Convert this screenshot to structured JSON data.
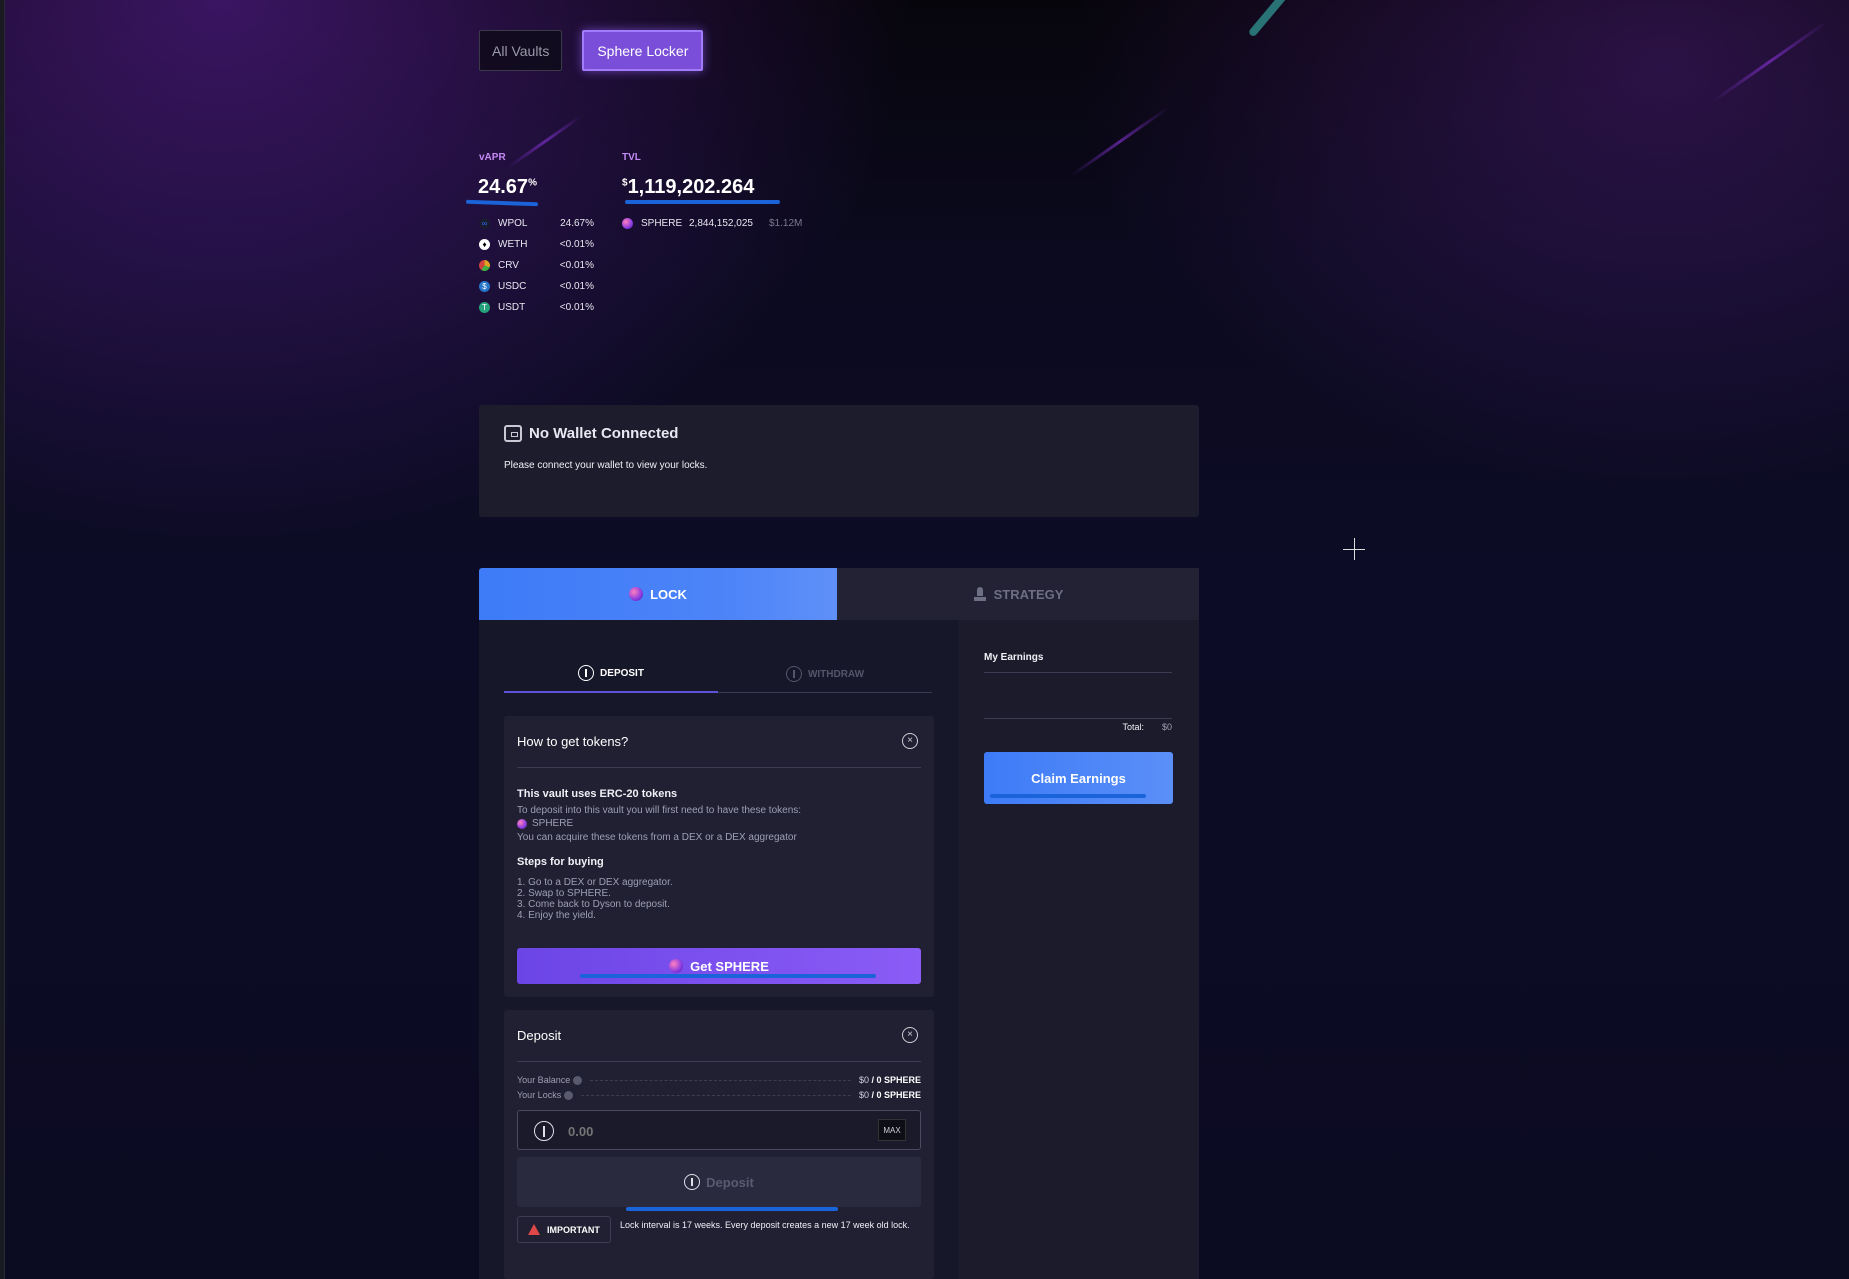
{
  "top_tabs": {
    "all_vaults": "All Vaults",
    "sphere_locker": "Sphere Locker"
  },
  "stats": {
    "vapr_label": "vAPR",
    "vapr_value": "24.67",
    "vapr_unit": "%",
    "tvl_label": "TVL",
    "tvl_currency": "$",
    "tvl_value": "1,119,202.264",
    "apr_breakdown": [
      {
        "token": "WPOL",
        "value": "24.67%",
        "icon": "wpol-icon",
        "color": "#2b6bf3"
      },
      {
        "token": "WETH",
        "value": "<0.01%",
        "icon": "weth-icon",
        "color": "#ffffff"
      },
      {
        "token": "CRV",
        "value": "<0.01%",
        "icon": "crv-icon",
        "color": "#e0a020"
      },
      {
        "token": "USDC",
        "value": "<0.01%",
        "icon": "usdc-icon",
        "color": "#2775ca"
      },
      {
        "token": "USDT",
        "value": "<0.01%",
        "icon": "usdt-icon",
        "color": "#26a17b"
      }
    ],
    "tvl_breakdown": {
      "token": "SPHERE",
      "amount": "2,844,152,025",
      "usd": "$1.12M"
    }
  },
  "wallet": {
    "title": "No Wallet Connected",
    "message": "Please connect your wallet to view your locks."
  },
  "main_tabs": {
    "lock": "LOCK",
    "strategy": "STRATEGY"
  },
  "sub_tabs": {
    "deposit": "DEPOSIT",
    "withdraw": "WITHDRAW"
  },
  "how_to": {
    "title": "How to get tokens?",
    "close": "×",
    "erc_heading": "This vault uses ERC-20 tokens",
    "erc_text": "To deposit into this vault you will first need to have these tokens:",
    "token": "SPHERE",
    "acquire_text": "You can acquire these tokens from a DEX or a DEX aggregator",
    "steps_heading": "Steps for buying",
    "steps": [
      "1. Go to a DEX or DEX aggregator.",
      "2. Swap to SPHERE.",
      "3. Come back to Dyson to deposit.",
      "4. Enjoy the yield."
    ],
    "get_button": "Get SPHERE"
  },
  "deposit": {
    "title": "Deposit",
    "close": "×",
    "balance_label": "Your Balance",
    "balance_usd": "$0",
    "balance_token": "/ 0 SPHERE",
    "locks_label": "Your Locks",
    "locks_usd": "$0",
    "locks_token": "/ 0 SPHERE",
    "amount_placeholder": "0.00",
    "max_label": "MAX",
    "deposit_button": "Deposit",
    "important_label": "IMPORTANT",
    "lock_note": "Lock interval is 17 weeks. Every deposit creates a new 17 week old lock."
  },
  "earnings": {
    "title": "My Earnings",
    "total_label": "Total:",
    "total_value": "$0",
    "claim_button": "Claim Earnings"
  },
  "colors": {
    "accent_blue": "#3d7bf7",
    "accent_purple": "#7a4ed8",
    "annotation": "#1a63d9"
  }
}
